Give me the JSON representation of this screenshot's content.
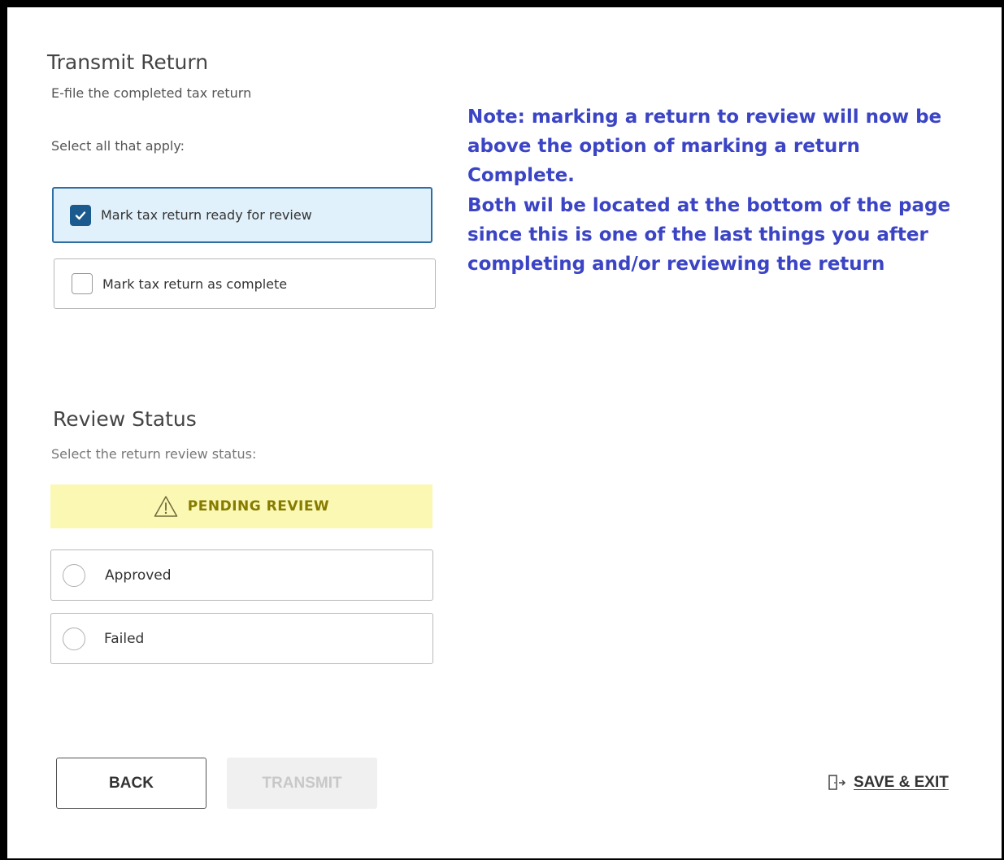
{
  "transmit": {
    "title": "Transmit Return",
    "subtitle": "E-file the completed tax return",
    "instruction": "Select all that apply:",
    "options": [
      {
        "label": "Mark tax return ready for review",
        "checked": true
      },
      {
        "label": "Mark tax return as complete",
        "checked": false
      }
    ]
  },
  "review": {
    "title": "Review Status",
    "instruction": "Select the return review status:",
    "status_banner": "PENDING REVIEW",
    "status_icon": "warning-triangle-icon",
    "options": [
      {
        "label": "Approved",
        "selected": false
      },
      {
        "label": "Failed",
        "selected": false
      }
    ]
  },
  "note": {
    "line1": "Note:  marking a return to review will now be",
    "line2": "above the option of marking a return Complete.",
    "line3": "Both wil be located at the bottom of the page",
    "line4": "since this is one of the last things you after",
    "line5": "completing and/or reviewing the return"
  },
  "footer": {
    "back_label": "BACK",
    "transmit_label": "TRANSMIT",
    "save_exit_label": "SAVE & EXIT",
    "save_exit_icon": "exit-door-icon"
  },
  "colors": {
    "note_text": "#3b44c4",
    "selected_border": "#2f6ea3",
    "selected_bg": "#e1f1fb",
    "checkbox_checked": "#1a5a8e",
    "pending_bg": "#fbf8b4",
    "pending_text": "#857b00"
  }
}
